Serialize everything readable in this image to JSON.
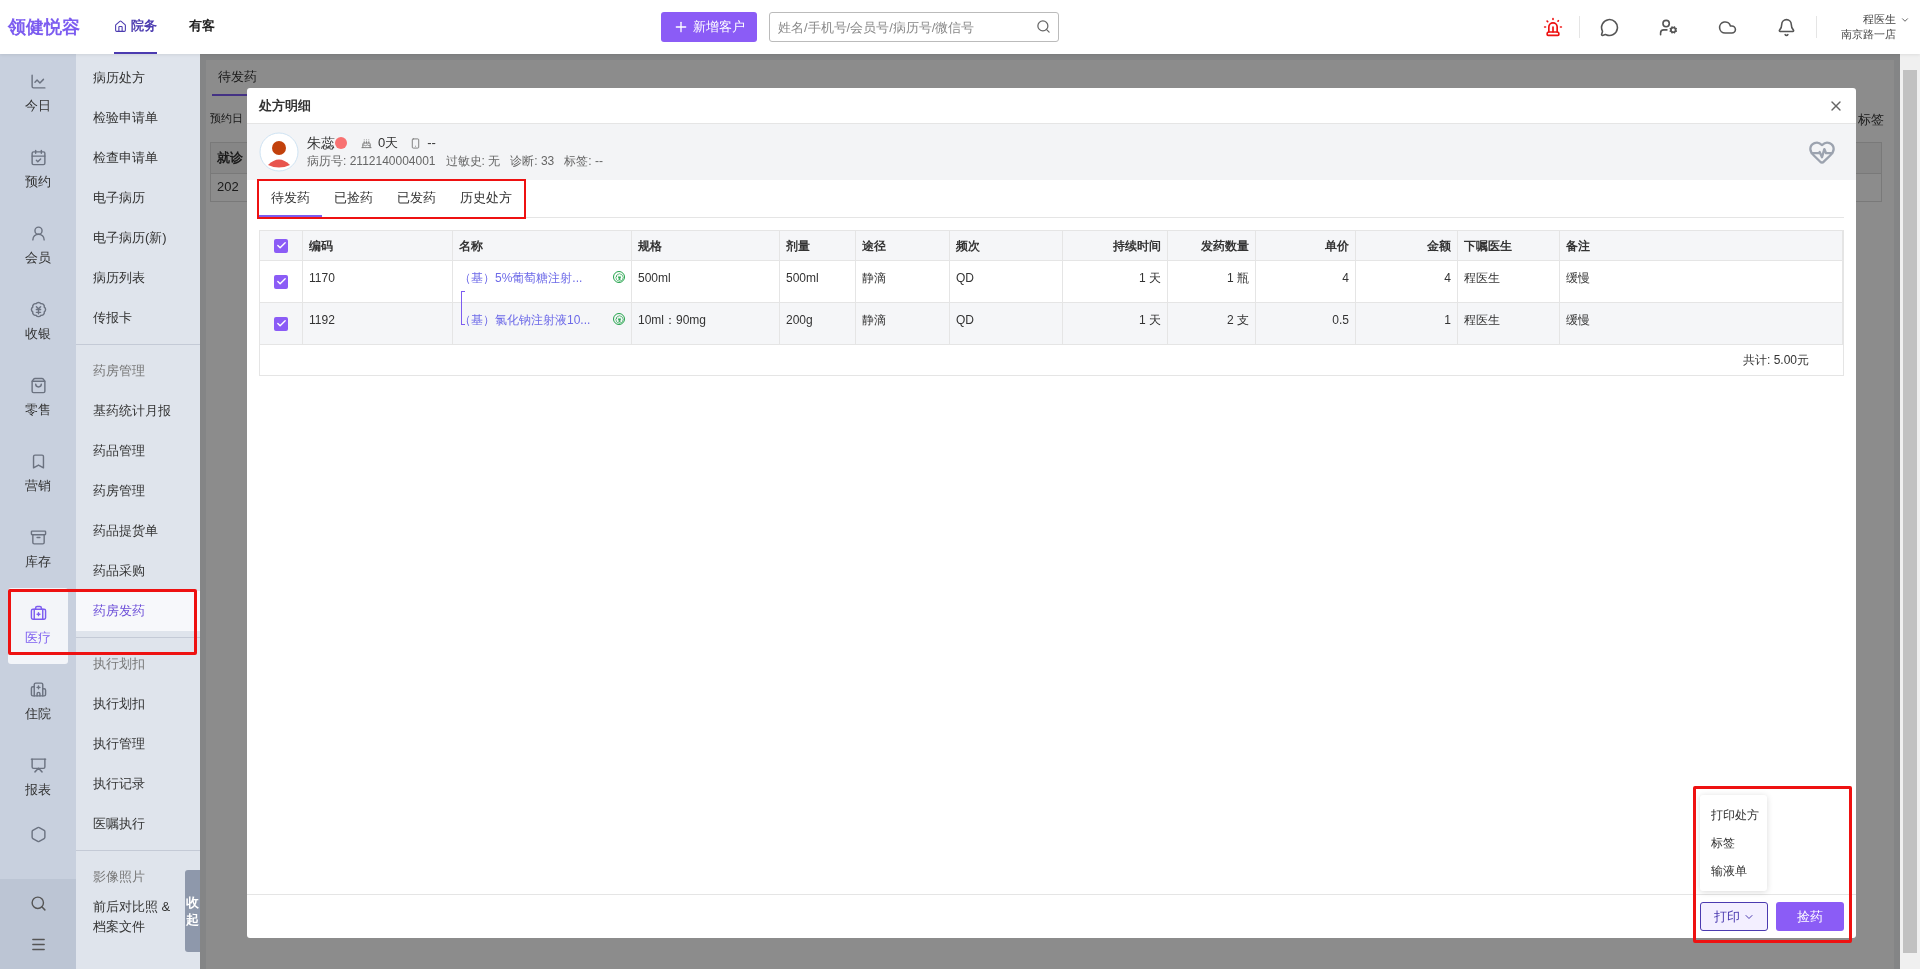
{
  "topbar": {
    "logo": "领健悦容",
    "nav": [
      {
        "label": "院务",
        "selected": true
      },
      {
        "label": "有客",
        "selected": false
      }
    ],
    "add_button": "新增客户",
    "search": {
      "placeholder": "姓名/手机号/会员号/病历号/微信号"
    },
    "user": {
      "name": "程医生",
      "store": "南京路一店"
    }
  },
  "rail": {
    "items": [
      {
        "label": "今日",
        "selected": false
      },
      {
        "label": "预约",
        "selected": false
      },
      {
        "label": "会员",
        "selected": false
      },
      {
        "label": "收银",
        "selected": false
      },
      {
        "label": "零售",
        "selected": false
      },
      {
        "label": "营销",
        "selected": false
      },
      {
        "label": "库存",
        "selected": false
      },
      {
        "label": "医疗",
        "selected": true
      },
      {
        "label": "住院",
        "selected": false
      },
      {
        "label": "报表",
        "selected": false
      }
    ]
  },
  "submenu": {
    "groups": [
      {
        "items": [
          {
            "label": "病历处方",
            "selected": false
          },
          {
            "label": "检验申请单",
            "selected": false
          },
          {
            "label": "检查申请单",
            "selected": false
          },
          {
            "label": "电子病历",
            "selected": false
          },
          {
            "label": "电子病历(新)",
            "selected": false
          },
          {
            "label": "病历列表",
            "selected": false
          },
          {
            "label": "传报卡",
            "selected": false
          }
        ]
      },
      {
        "items": [
          {
            "label": "药房管理",
            "selected": false
          },
          {
            "label": "基药统计月报",
            "selected": false
          },
          {
            "label": "药品管理",
            "selected": false
          },
          {
            "label": "药房管理",
            "selected": false
          },
          {
            "label": "药品提货单",
            "selected": false
          },
          {
            "label": "药品采购",
            "selected": false
          },
          {
            "label": "药房发药",
            "selected": true
          }
        ]
      },
      {
        "items": [
          {
            "label": "执行划扣",
            "selected": false
          },
          {
            "label": "执行划扣",
            "selected": false
          },
          {
            "label": "执行管理",
            "selected": false
          },
          {
            "label": "执行记录",
            "selected": false
          },
          {
            "label": "医嘱执行",
            "selected": false
          }
        ]
      },
      {
        "items": [
          {
            "label": "影像照片",
            "selected": false
          },
          {
            "label": "前后对比照 & 档案文件",
            "selected": false
          }
        ]
      }
    ],
    "collapse": "收起"
  },
  "background": {
    "tab": "待发药",
    "filter_label": "预约日",
    "column": "就诊",
    "cell": "202",
    "right_label": "标签"
  },
  "modal": {
    "title": "处方明细",
    "patient": {
      "name": "朱蕊",
      "age": "0天",
      "phone": "--",
      "record_no": "病历号: 2112140004001",
      "allergy": "过敏史: 无",
      "diagnosis": "诊断: 33",
      "tags": "标签: --"
    },
    "tabs": [
      {
        "label": "待发药",
        "selected": true
      },
      {
        "label": "已捡药",
        "selected": false
      },
      {
        "label": "已发药",
        "selected": false
      },
      {
        "label": "历史处方",
        "selected": false
      }
    ],
    "table": {
      "all_checked": true,
      "columns": [
        "编码",
        "名称",
        "规格",
        "剂量",
        "途径",
        "频次",
        "持续时间",
        "发药数量",
        "单价",
        "金额",
        "下嘱医生",
        "备注"
      ],
      "rows": [
        {
          "checked": true,
          "cells": [
            "1170",
            "（基）5%葡萄糖注射...",
            "500ml",
            "500ml",
            "静滴",
            "QD",
            "1 天",
            "1 瓶",
            "4",
            "4",
            "程医生",
            "缓慢"
          ]
        },
        {
          "checked": true,
          "cells": [
            "1192",
            "（基）氯化钠注射液10...",
            "10ml：90mg",
            "200g",
            "静滴",
            "QD",
            "1 天",
            "2 支",
            "0.5",
            "1",
            "程医生",
            "缓慢"
          ]
        }
      ],
      "total": "共计: 5.00元"
    },
    "print_menu": [
      "打印处方",
      "标签",
      "输液单"
    ],
    "print_button": "打印",
    "pick_button": "捡药"
  }
}
